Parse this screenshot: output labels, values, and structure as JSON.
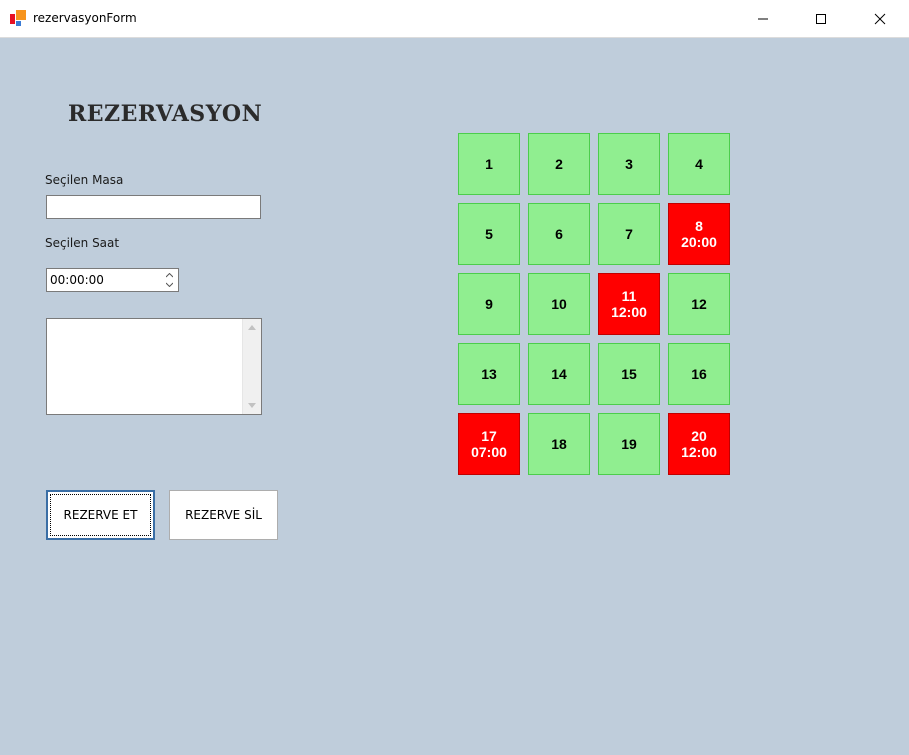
{
  "window": {
    "title": "rezervasyonForm",
    "minimize_icon": "minimize-icon",
    "maximize_icon": "maximize-icon",
    "close_icon": "close-icon"
  },
  "form": {
    "heading": "REZERVASYON",
    "table_label": "Seçilen Masa",
    "table_value": "",
    "time_label": "Seçilen Saat",
    "time_value": "00:00:00",
    "notes_value": ""
  },
  "buttons": {
    "reserve": "REZERVE ET",
    "delete": "REZERVE SİL"
  },
  "colors": {
    "background": "#bfcddb",
    "free_table": "#90ee90",
    "reserved_table": "#ff0000"
  },
  "tables": [
    {
      "number": "1",
      "time": "",
      "reserved": false
    },
    {
      "number": "2",
      "time": "",
      "reserved": false
    },
    {
      "number": "3",
      "time": "",
      "reserved": false
    },
    {
      "number": "4",
      "time": "",
      "reserved": false
    },
    {
      "number": "5",
      "time": "",
      "reserved": false
    },
    {
      "number": "6",
      "time": "",
      "reserved": false
    },
    {
      "number": "7",
      "time": "",
      "reserved": false
    },
    {
      "number": "8",
      "time": "20:00",
      "reserved": true
    },
    {
      "number": "9",
      "time": "",
      "reserved": false
    },
    {
      "number": "10",
      "time": "",
      "reserved": false
    },
    {
      "number": "11",
      "time": "12:00",
      "reserved": true
    },
    {
      "number": "12",
      "time": "",
      "reserved": false
    },
    {
      "number": "13",
      "time": "",
      "reserved": false
    },
    {
      "number": "14",
      "time": "",
      "reserved": false
    },
    {
      "number": "15",
      "time": "",
      "reserved": false
    },
    {
      "number": "16",
      "time": "",
      "reserved": false
    },
    {
      "number": "17",
      "time": "07:00",
      "reserved": true
    },
    {
      "number": "18",
      "time": "",
      "reserved": false
    },
    {
      "number": "19",
      "time": "",
      "reserved": false
    },
    {
      "number": "20",
      "time": "12:00",
      "reserved": true
    }
  ]
}
